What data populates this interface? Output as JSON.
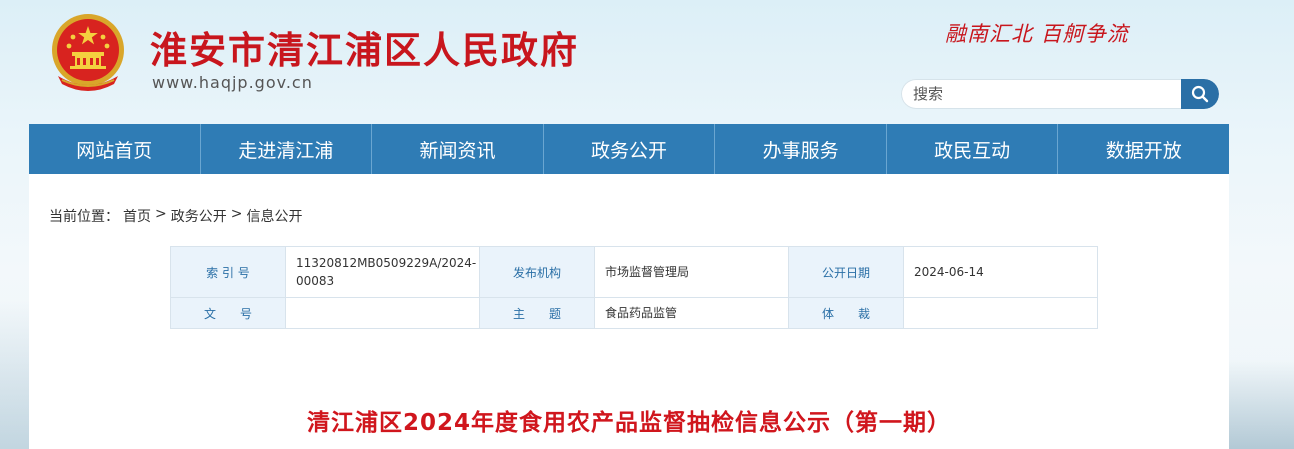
{
  "header": {
    "site_title": "淮安市清江浦区人民政府",
    "site_url": "www.haqjp.gov.cn",
    "slogan": "融南汇北 百舸争流",
    "brand_color": "#c8161d",
    "emblem_icon": "national-emblem-icon"
  },
  "search": {
    "placeholder": "搜索",
    "value": "",
    "button_icon": "search-icon"
  },
  "nav": {
    "items": [
      "网站首页",
      "走进清江浦",
      "新闻资讯",
      "政务公开",
      "办事服务",
      "政民互动",
      "数据开放"
    ],
    "bg_color": "#2f7cb5"
  },
  "breadcrumb": {
    "prefix": "当前位置：",
    "items": [
      "首页",
      "政务公开",
      "信息公开"
    ],
    "separator": ">"
  },
  "meta": {
    "index_label": "索 引 号",
    "index_value": "11320812MB0509229A/2024-00083",
    "publisher_label": "发布机构",
    "publisher_value": "市场监督管理局",
    "date_label": "公开日期",
    "date_value": "2024-06-14",
    "doc_no_label": "文　　号",
    "doc_no_value": "",
    "subject_label": "主　　题",
    "subject_value": "食品药品监管",
    "genre_label": "体　　裁",
    "genre_value": ""
  },
  "article": {
    "title": "清江浦区2024年度食用农产品监督抽检信息公示（第一期）"
  }
}
